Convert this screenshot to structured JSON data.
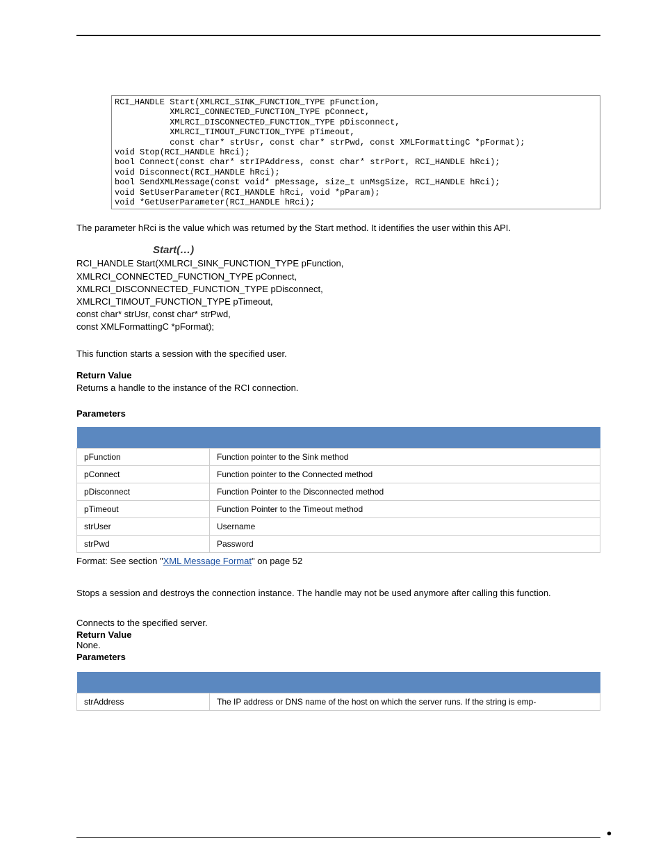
{
  "code": "RCI_HANDLE Start(XMLRCI_SINK_FUNCTION_TYPE pFunction,\n           XMLRCI_CONNECTED_FUNCTION_TYPE pConnect,\n           XMLRCI_DISCONNECTED_FUNCTION_TYPE pDisconnect,\n           XMLRCI_TIMOUT_FUNCTION_TYPE pTimeout,\n           const char* strUsr, const char* strPwd, const XMLFormattingC *pFormat);\nvoid Stop(RCI_HANDLE hRci);\nbool Connect(const char* strIPAddress, const char* strPort, RCI_HANDLE hRci);\nvoid Disconnect(RCI_HANDLE hRci);\nbool SendXMLMessage(const void* pMessage, size_t unMsgSize, RCI_HANDLE hRci);\nvoid SetUserParameter(RCI_HANDLE hRci, void *pParam);\nvoid *GetUserParameter(RCI_HANDLE hRci);",
  "intro": "The parameter hRci is the value which was returned by the Start method. It identifies the user within this API.",
  "start": {
    "title": "Start(…)",
    "sig": "RCI_HANDLE Start(XMLRCI_SINK_FUNCTION_TYPE pFunction,\nXMLRCI_CONNECTED_FUNCTION_TYPE pConnect,\nXMLRCI_DISCONNECTED_FUNCTION_TYPE pDisconnect,\nXMLRCI_TIMOUT_FUNCTION_TYPE pTimeout,\nconst char* strUsr, const char* strPwd,\nconst XMLFormattingC *pFormat);",
    "desc": "This function starts a session with the specified user.",
    "return_label": "Return Value",
    "return_text": "Returns a handle to the instance of the RCI connection.",
    "params_label": "Parameters",
    "params": [
      {
        "name": "pFunction",
        "desc": "Function pointer to the Sink method"
      },
      {
        "name": "pConnect",
        "desc": "Function pointer to the Connected method"
      },
      {
        "name": "pDisconnect",
        "desc": "Function Pointer to the Disconnected method"
      },
      {
        "name": "pTimeout",
        "desc": "Function Pointer to the Timeout method"
      },
      {
        "name": "strUser",
        "desc": "Username"
      },
      {
        "name": "strPwd",
        "desc": "Password"
      }
    ],
    "format_pre": "Format: See section \"",
    "format_link": "XML Message Format",
    "format_post": "\" on page 52"
  },
  "stop": {
    "text": "Stops a session and destroys the connection instance. The handle may not be used anymore after calling this function."
  },
  "connect": {
    "desc": "Connects to the specified server.",
    "return_label": "Return Value",
    "return_text": "None.",
    "params_label": "Parameters",
    "params": [
      {
        "name": "strAddress",
        "desc": "The IP address or DNS name of the host on which the server runs. If the string is emp-"
      }
    ]
  }
}
